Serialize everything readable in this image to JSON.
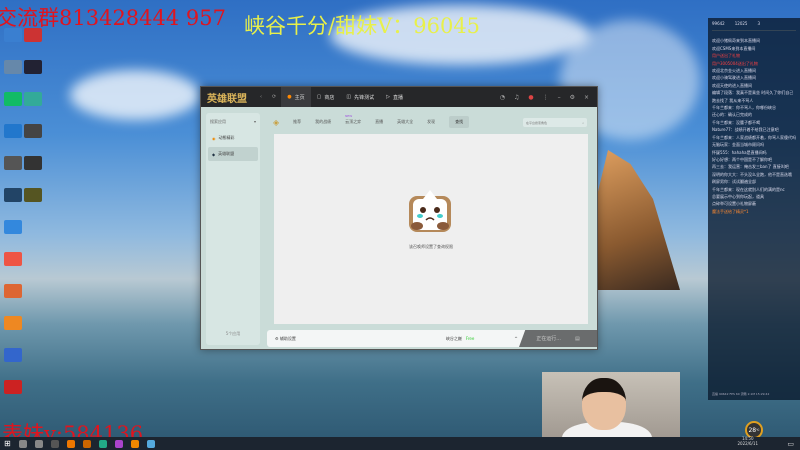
{
  "overlays": {
    "group": "交流群813428444 957",
    "wechat": "峡谷千分/甜妹V：96045",
    "cousin": "表妹v:584136"
  },
  "client": {
    "logo": "英雄联盟",
    "tabs": [
      {
        "label": "主页"
      },
      {
        "label": "商店"
      },
      {
        "label": "先锋测试"
      },
      {
        "label": "直播"
      }
    ],
    "sidebar": {
      "search": "搜索应用",
      "items": [
        {
          "label": "动態精彩"
        },
        {
          "label": "英雄联盟"
        }
      ],
      "footer": "5个应用"
    },
    "topnav": [
      "推荐",
      "我的战绩",
      "云顶之弈",
      "直播",
      "英雄大全",
      "发现",
      "查找"
    ],
    "new_badge": "NEW",
    "search_placeholder": "在平台搜索角色",
    "empty_message": "该召唤师设置了查询权限",
    "footer": {
      "settings": "辅助设置",
      "region": "峡谷之巅",
      "status": "Free",
      "running": "正在运行..."
    }
  },
  "chat": {
    "header": [
      "99642",
      "12025",
      "3"
    ],
    "messages": [
      {
        "text": "欢迎小猪佩奇来到本直播间",
        "color": "normal"
      },
      {
        "text": "欢迎CSMS来到本直播间",
        "color": "normal"
      },
      {
        "text": "用户送出了礼物",
        "color": "red"
      },
      {
        "text": "用户3005004送出了礼物",
        "color": "red"
      },
      {
        "text": "欢迎北京金火进入直播间",
        "color": "normal"
      },
      {
        "text": "欢迎小骑驾驶进入直播间",
        "color": "normal"
      },
      {
        "text": "欢迎天使的进入直播间",
        "color": "normal"
      },
      {
        "text": "编辑了段落：我真不是乘坐 时间久了你们自己跑去找了 我从来不骂人",
        "color": "normal"
      },
      {
        "text": "千年兰都来：你不骂人，你哪份峡谷",
        "color": "normal"
      },
      {
        "text": "还心的：确认已完成的",
        "color": "normal"
      },
      {
        "text": "千年兰都来：没腰子都不喝",
        "color": "normal"
      },
      {
        "text": "Nature77：战绩开着不给我已注意吧",
        "color": "normal"
      },
      {
        "text": "千年兰都来：人家战绩都开着，你骂人家傻代吗",
        "color": "normal"
      },
      {
        "text": "无脑玩家：金面当城市顾问吗",
        "color": "normal"
      },
      {
        "text": "怀疑555：hahaha是直播间吗",
        "color": "normal"
      },
      {
        "text": "好心好想：两个中国是不了解你吧",
        "color": "normal"
      },
      {
        "text": "再三去：我运营：俺击发三ban了 直接叫吧",
        "color": "normal"
      },
      {
        "text": "深明的你大大：不头没么全跑，他不是直选哦",
        "color": "normal"
      },
      {
        "text": "刷屏男你：试试翻遍全部",
        "color": "normal"
      },
      {
        "text": "千年兰都来：现在这就别人们的满的是nc",
        "color": "normal"
      },
      {
        "text": "总要展示中心到你玩起，道具",
        "color": "normal"
      },
      {
        "text": "点碎举可设置小礼物屏蔽",
        "color": "normal"
      },
      {
        "text": "魔法手送给了精灵*1",
        "color": "orange"
      }
    ],
    "stats": "直播 99642 FPS 60 流畅 2.1M 15:29:42"
  },
  "tray": {
    "temperature": "28",
    "unit": "℃",
    "time": "14:50",
    "date": "2022/6/11"
  }
}
